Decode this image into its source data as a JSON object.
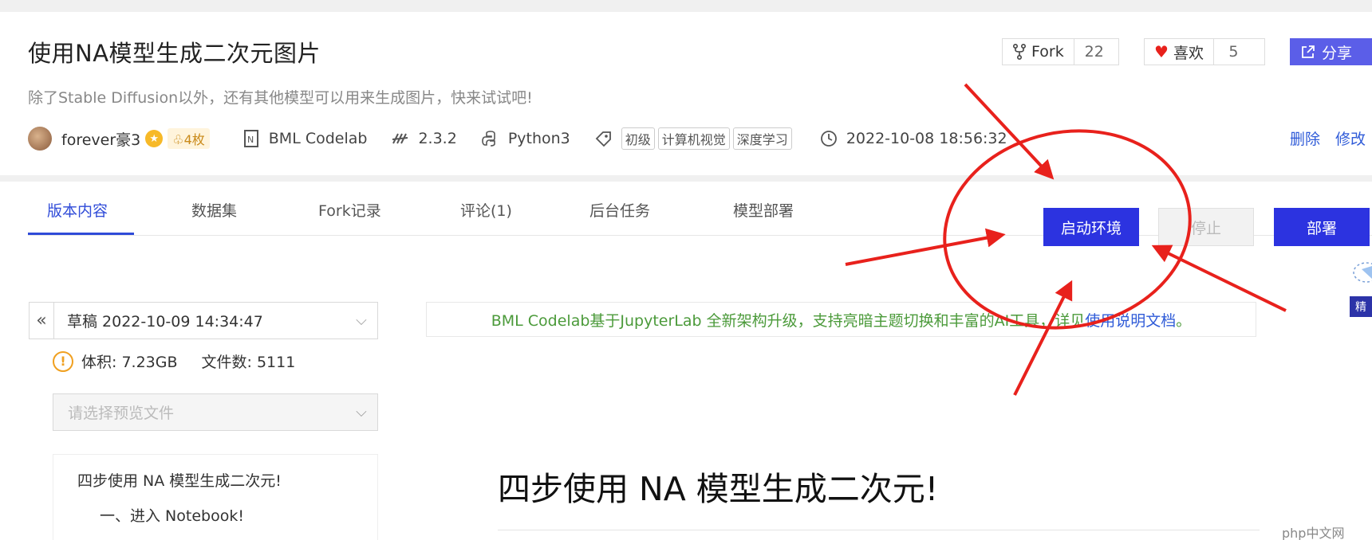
{
  "header": {
    "title": "使用NA模型生成二次元图片",
    "subtitle": "除了Stable Diffusion以外，还有其他模型可以用来生成图片，快来试试吧!",
    "fork": {
      "label": "Fork",
      "count": "22"
    },
    "like": {
      "label": "喜欢",
      "count": "5"
    },
    "share": {
      "label": "分享"
    },
    "delete_label": "删除",
    "edit_label": "修改"
  },
  "meta": {
    "author": "forever豪3",
    "medal": "4枚",
    "platform": "BML Codelab",
    "version": "2.3.2",
    "language": "Python3",
    "tags": [
      "初级",
      "计算机视觉",
      "深度学习"
    ],
    "datetime": "2022-10-08 18:56:32"
  },
  "tabs": [
    {
      "label": "版本内容",
      "active": true
    },
    {
      "label": "数据集"
    },
    {
      "label": "Fork记录"
    },
    {
      "label": "评论(1)"
    },
    {
      "label": "后台任务"
    },
    {
      "label": "模型部署"
    }
  ],
  "actions": {
    "start": "启动环境",
    "stop": "停止",
    "deploy": "部署"
  },
  "sidebar": {
    "version_select": "草稿 2022-10-09 14:34:47",
    "size_label": "体积: 7.23GB",
    "files_label": "文件数: 5111",
    "file_placeholder": "请选择预览文件",
    "toc": [
      "四步使用 NA 模型生成二次元!",
      "一、进入 Notebook!"
    ]
  },
  "notice": {
    "text": "BML Codelab基于JupyterLab 全新架构升级，支持亮暗主题切换和丰富的AI工具，详见",
    "link": "使用说明文档",
    "suffix": "。"
  },
  "content": {
    "heading": "四步使用 NA 模型生成二次元!"
  },
  "side_float": {
    "label": "精"
  },
  "watermark": "php中文网",
  "colors": {
    "primary": "#2c33e0",
    "link": "#2f5bd8",
    "annotation": "#e8211c",
    "notice_green": "#4b9a3a"
  }
}
